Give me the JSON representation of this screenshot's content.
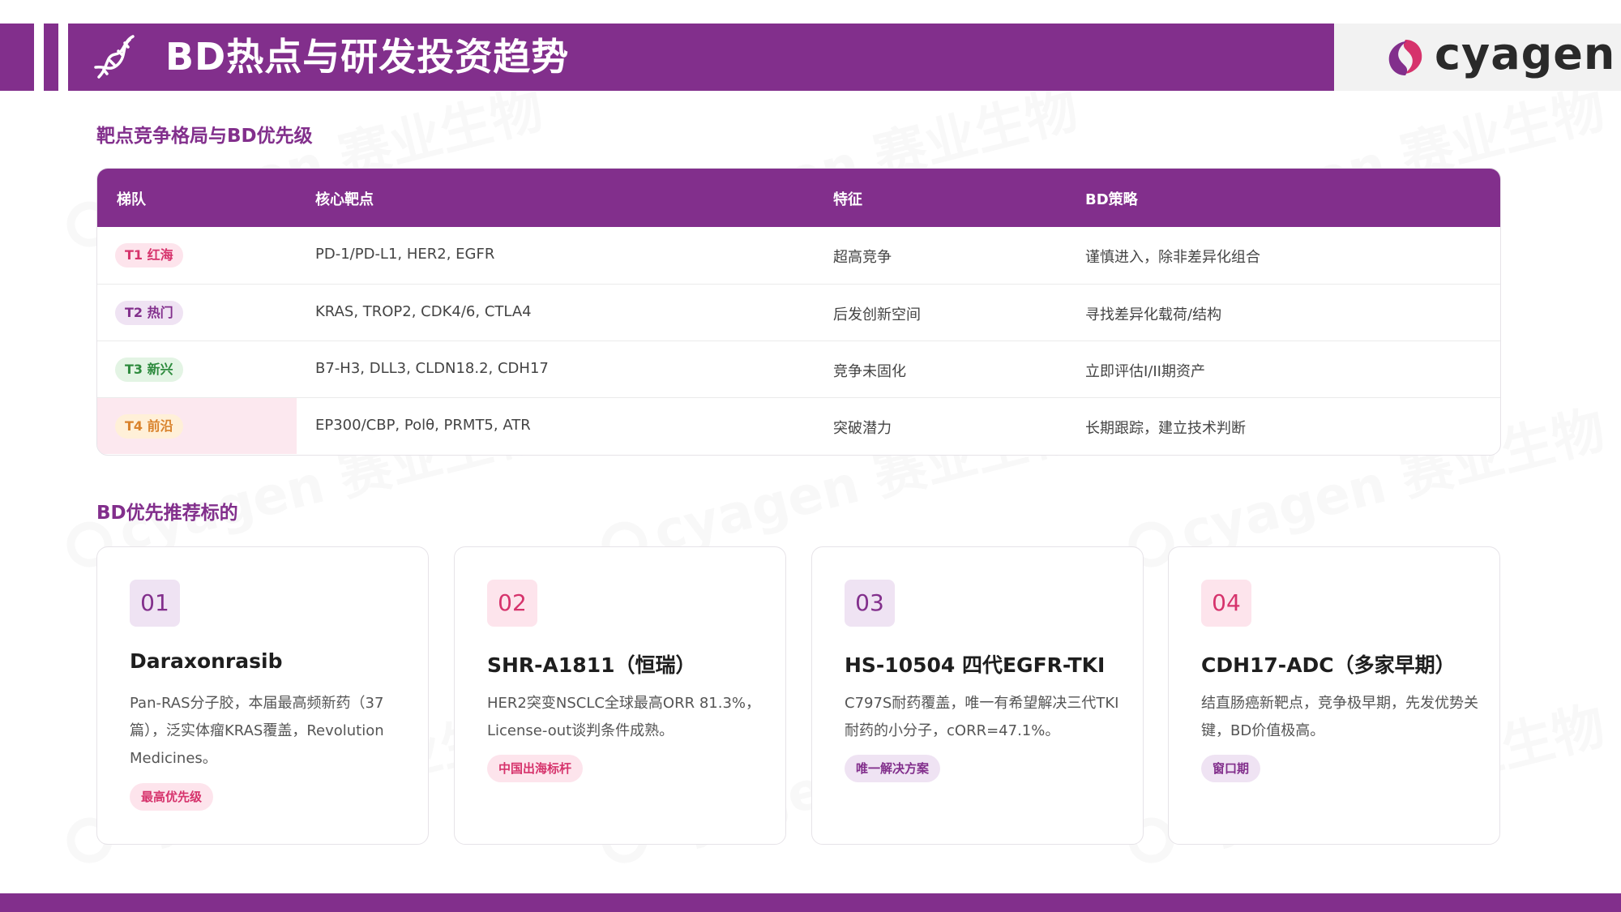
{
  "header": {
    "title": "BD热点与研发投资趋势",
    "logo_text": "cyagen",
    "watermark_text": "cyagen 赛业生物"
  },
  "section1": {
    "title": "靶点竞争格局与BD优先级"
  },
  "table": {
    "headers": [
      "梯队",
      "核心靶点",
      "特征",
      "BD策略"
    ],
    "rows": [
      {
        "tier": "T1 红海",
        "targets": "PD-1/PD-L1, HER2, EGFR",
        "feature": "超高竞争",
        "strategy": "谨慎进入，除非差异化组合"
      },
      {
        "tier": "T2 热门",
        "targets": "KRAS, TROP2, CDK4/6, CTLA4",
        "feature": "后发创新空间",
        "strategy": "寻找差异化载荷/结构"
      },
      {
        "tier": "T3 新兴",
        "targets": "B7-H3, DLL3, CLDN18.2, CDH17",
        "feature": "竞争未固化",
        "strategy": "立即评估I/II期资产"
      },
      {
        "tier": "T4 前沿",
        "targets": "EP300/CBP, Polθ, PRMT5, ATR",
        "feature": "突破潜力",
        "strategy": "长期跟踪，建立技术判断"
      }
    ]
  },
  "section2": {
    "title": "BD优先推荐标的"
  },
  "cards": [
    {
      "num": "01",
      "title": "Daraxonrasib",
      "desc": "Pan-RAS分子胶，本届最高频新药（37篇），泛实体瘤KRAS覆盖，Revolution Medicines。",
      "tag": "最高优先级"
    },
    {
      "num": "02",
      "title": "SHR-A1811（恒瑞）",
      "desc": "HER2突变NSCLC全球最高ORR 81.3%，License-out谈判条件成熟。",
      "tag": "中国出海标杆"
    },
    {
      "num": "03",
      "title": "HS-10504 四代EGFR-TKI",
      "desc": "C797S耐药覆盖，唯一有希望解决三代TKI耐药的小分子，cORR=47.1%。",
      "tag": "唯一解决方案"
    },
    {
      "num": "04",
      "title": "CDH17-ADC（多家早期）",
      "desc": "结直肠癌新靶点，竞争极早期，先发优势关键，BD价值极高。",
      "tag": "窗口期"
    }
  ],
  "colors": {
    "primary": "#822f8c",
    "t1_bg": "#fde4ec",
    "t1_fg": "#d6336c",
    "t2_bg": "#efe3f3",
    "t2_fg": "#822f8c",
    "t3_bg": "#e3f4e4",
    "t3_fg": "#2e8b3e",
    "t4_bg": "#fff0d8",
    "t4_fg": "#d9822b"
  },
  "icons": {
    "header": "dna-icon",
    "logo": "cyagen-logo-mark"
  }
}
